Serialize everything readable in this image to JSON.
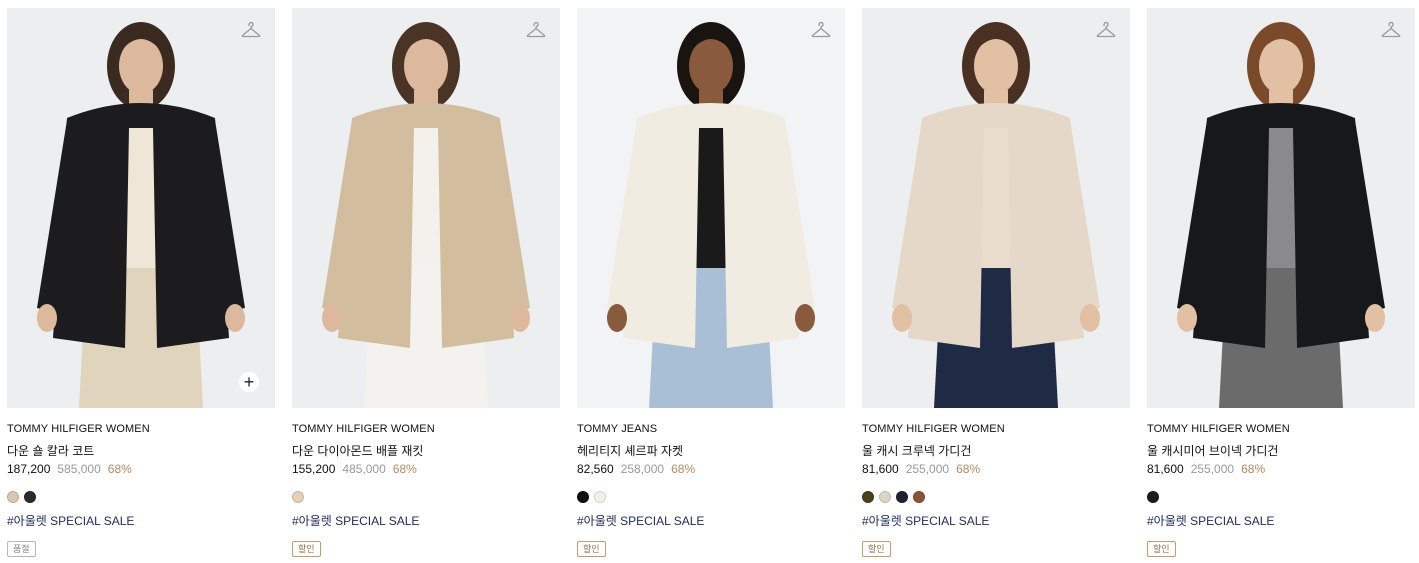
{
  "products": [
    {
      "brand": "TOMMY HILFIGER WOMEN",
      "name": "다운 숄 칼라 코트",
      "sale_price": "187,200",
      "original_price": "585,000",
      "discount": "68%",
      "swatches": [
        "#d9c6b0",
        "#2a2a2a"
      ],
      "tag": "#아울렛 SPECIAL SALE",
      "badge": "품절",
      "badge_type": "soldout",
      "hanger_icon": "hanger-icon",
      "has_plus": true,
      "plus_label": "+",
      "photo_colors": {
        "bg": "#eceef0",
        "garment": "#1c1c1e",
        "inner": "#efe6d8",
        "bottom": "#e0d4bc",
        "skin": "#dcb89c",
        "hair": "#3b2a20"
      }
    },
    {
      "brand": "TOMMY HILFIGER WOMEN",
      "name": "다운 다이아몬드 배플 재킷",
      "sale_price": "155,200",
      "original_price": "485,000",
      "discount": "68%",
      "swatches": [
        "#e6d0b9"
      ],
      "tag": "#아울렛 SPECIAL SALE",
      "badge": "할인",
      "badge_type": "sale",
      "hanger_icon": "hanger-icon",
      "has_plus": false,
      "plus_label": "",
      "photo_colors": {
        "bg": "#eceef0",
        "garment": "#d3bd9f",
        "inner": "#f3f1ec",
        "bottom": "#f4f2ee",
        "skin": "#dcb89c",
        "hair": "#4a3426"
      }
    },
    {
      "brand": "TOMMY JEANS",
      "name": "헤리티지 셰르파 자켓",
      "sale_price": "82,560",
      "original_price": "258,000",
      "discount": "68%",
      "swatches": [
        "#111111",
        "#f4f1e8"
      ],
      "tag": "#아울렛 SPECIAL SALE",
      "badge": "할인",
      "badge_type": "sale",
      "hanger_icon": "hanger-icon",
      "has_plus": false,
      "plus_label": "",
      "photo_colors": {
        "bg": "#f2f3f4",
        "garment": "#f1ece2",
        "inner": "#1a1a1a",
        "bottom": "#a9bfd6",
        "skin": "#8a5a3c",
        "hair": "#1a1410"
      }
    },
    {
      "brand": "TOMMY HILFIGER WOMEN",
      "name": "울 캐시 크루넥 가디건",
      "sale_price": "81,600",
      "original_price": "255,000",
      "discount": "68%",
      "swatches": [
        "#4a3f1e",
        "#ddd4c4",
        "#1d2230",
        "#8a5535"
      ],
      "tag": "#아울렛 SPECIAL SALE",
      "badge": "할인",
      "badge_type": "sale",
      "hanger_icon": "hanger-icon",
      "has_plus": false,
      "plus_label": "",
      "photo_colors": {
        "bg": "#eceef0",
        "garment": "#e6d8c8",
        "inner": "#e9dccd",
        "bottom": "#1f2a44",
        "skin": "#e2c0a4",
        "hair": "#4a3022"
      }
    },
    {
      "brand": "TOMMY HILFIGER WOMEN",
      "name": "울 캐시미어 브이넥 가디건",
      "sale_price": "81,600",
      "original_price": "255,000",
      "discount": "68%",
      "swatches": [
        "#1c1c1c"
      ],
      "tag": "#아울렛 SPECIAL SALE",
      "badge": "할인",
      "badge_type": "sale",
      "hanger_icon": "hanger-icon",
      "has_plus": false,
      "plus_label": "",
      "photo_colors": {
        "bg": "#eceef0",
        "garment": "#17181a",
        "inner": "#8a8a8c",
        "bottom": "#6b6b6b",
        "skin": "#e2c0a4",
        "hair": "#7a4a2a"
      }
    }
  ]
}
